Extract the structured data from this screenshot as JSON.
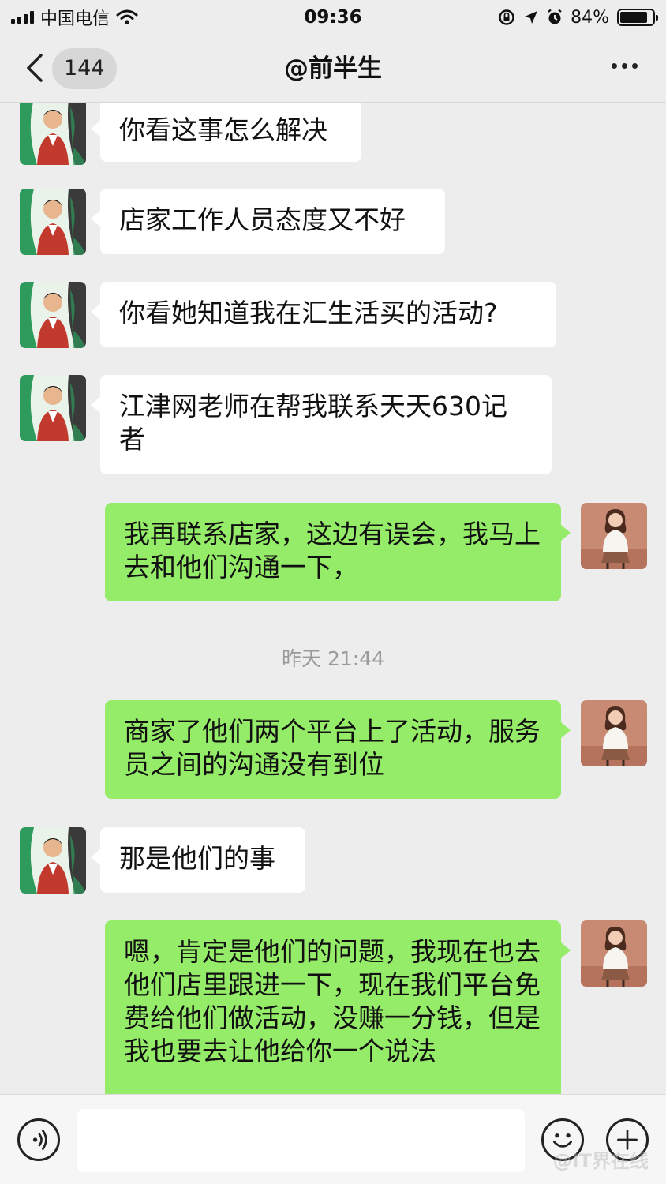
{
  "status_bar": {
    "carrier": "中国电信",
    "time": "09:36",
    "battery": "84%",
    "battery_level": 0.84
  },
  "nav": {
    "unread_count": "144",
    "title": "@前半生"
  },
  "messages": [
    {
      "direction": "in",
      "text": "你看这事怎么解决"
    },
    {
      "direction": "in",
      "text": "店家工作人员态度又不好"
    },
    {
      "direction": "in",
      "text": "你看她知道我在汇生活买的活动?"
    },
    {
      "direction": "in",
      "text": "江津网老师在帮我联系天天630记者"
    },
    {
      "direction": "out",
      "text": "我再联系店家，这边有误会，我马上去和他们沟通一下，"
    },
    {
      "direction": "time",
      "text": "昨天 21:44"
    },
    {
      "direction": "out",
      "text": "商家了他们两个平台上了活动，服务员之间的沟通没有到位"
    },
    {
      "direction": "in",
      "text": "那是他们的事"
    },
    {
      "direction": "out",
      "text": "嗯，肯定是他们的问题，我现在也去他们店里跟进一下，现在我们平台免费给他们做活动，没赚一分钱，但是我也要去让他给你一个说法"
    }
  ],
  "colors": {
    "background": "#ededed",
    "incoming_bubble": "#ffffff",
    "outgoing_bubble": "#95ec69"
  },
  "icons": {
    "back": "chevron-left-icon",
    "more": "ellipsis-icon",
    "voice": "voice-icon",
    "emoji": "emoji-icon",
    "plus": "plus-icon"
  }
}
